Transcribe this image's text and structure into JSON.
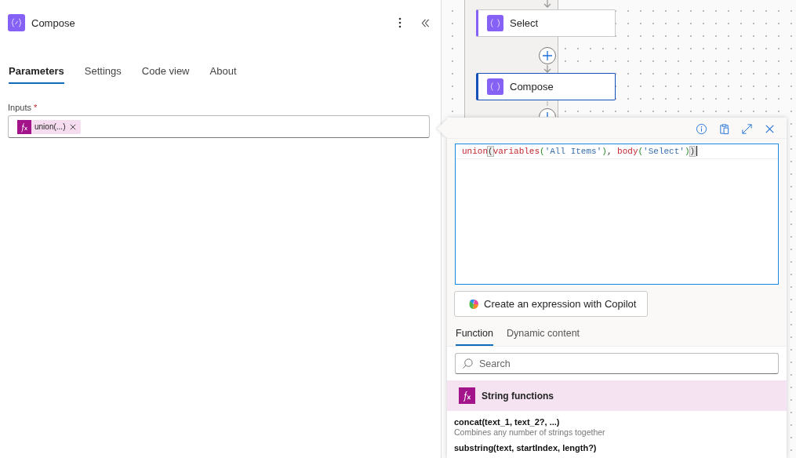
{
  "panel": {
    "title": "Compose",
    "tabs": [
      {
        "label": "Parameters",
        "selected": true
      },
      {
        "label": "Settings",
        "selected": false
      },
      {
        "label": "Code view",
        "selected": false
      },
      {
        "label": "About",
        "selected": false
      }
    ],
    "inputs": {
      "label": "Inputs",
      "required_mark": "*",
      "token": "union(...)"
    }
  },
  "canvas": {
    "nodes": [
      {
        "label": "Select",
        "selected": false
      },
      {
        "label": "Compose",
        "selected": true
      }
    ]
  },
  "expression_editor": {
    "code_tokens": [
      {
        "text": "union",
        "kind": "func"
      },
      {
        "text": "(",
        "kind": "match"
      },
      {
        "text": "variables",
        "kind": "func"
      },
      {
        "text": "(",
        "kind": "paren"
      },
      {
        "text": "'All Items'",
        "kind": "string"
      },
      {
        "text": ")",
        "kind": "paren"
      },
      {
        "text": ", ",
        "kind": "punct"
      },
      {
        "text": "body",
        "kind": "func"
      },
      {
        "text": "(",
        "kind": "paren"
      },
      {
        "text": "'Select'",
        "kind": "string"
      },
      {
        "text": ")",
        "kind": "paren"
      },
      {
        "text": ")",
        "kind": "match"
      }
    ],
    "copilot_button": "Create an expression with Copilot",
    "tabs": [
      {
        "label": "Function",
        "selected": true
      },
      {
        "label": "Dynamic content",
        "selected": false
      }
    ],
    "search": {
      "placeholder": "Search"
    },
    "category": "String functions",
    "functions": [
      {
        "signature": "concat(text_1, text_2?, ...)",
        "description": "Combines any number of strings together"
      },
      {
        "signature": "substring(text, startIndex, length?)"
      }
    ]
  }
}
